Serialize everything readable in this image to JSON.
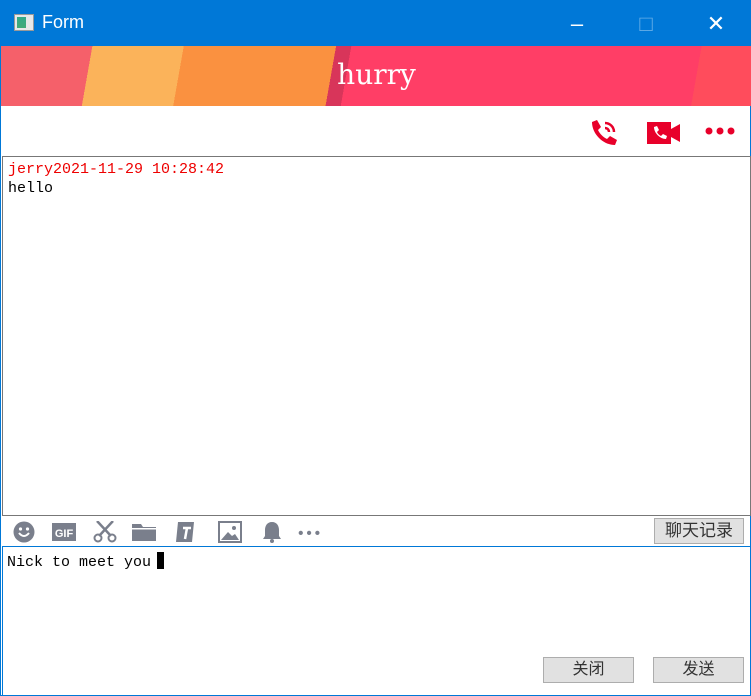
{
  "window": {
    "title": "Form"
  },
  "banner": {
    "title": "hurry"
  },
  "messages": [
    {
      "sender": "jerry",
      "timestamp": "2021-11-29 10:28:42",
      "text": "hello"
    }
  ],
  "toolbar": {
    "history_label": "聊天记录"
  },
  "input": {
    "value": "Nick to meet you"
  },
  "buttons": {
    "close": "关闭",
    "send": "发送"
  },
  "colors": {
    "accent": "#e8002a",
    "titlebar": "#0078d7",
    "icons": "#7a7f8c"
  }
}
